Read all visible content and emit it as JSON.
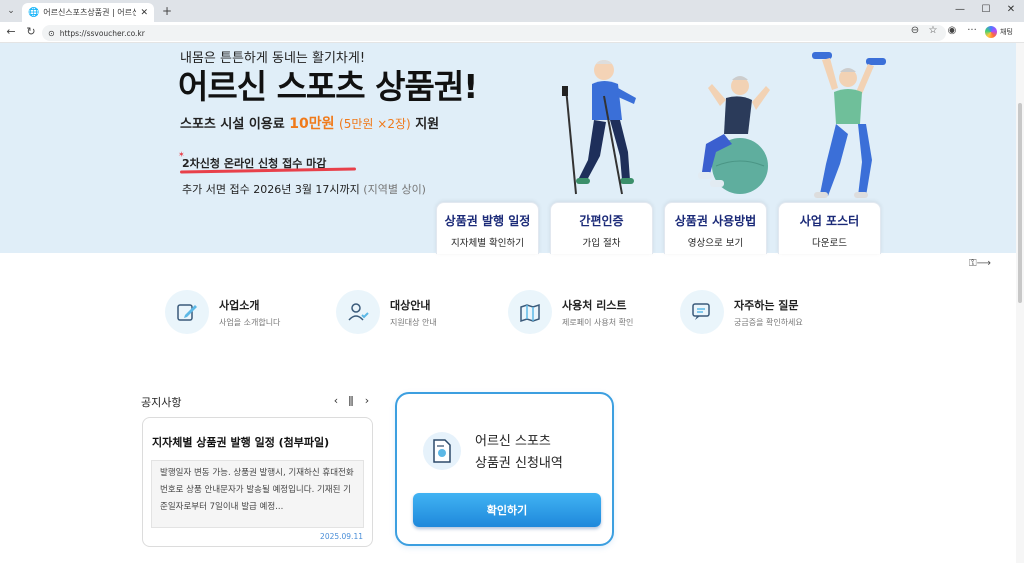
{
  "browser": {
    "tab_title": "어르신스포츠상품권 | 어르신스포",
    "url": "https://ssvoucher.co.kr",
    "copilot_label": "채팅"
  },
  "hero": {
    "subtitle": "내몸은 튼튼하게 동네는 활기차게!",
    "title": "어르신 스포츠 상품권!",
    "support_prefix": "스포츠 시설 이용료",
    "support_amount": "10만원",
    "support_detail": "(5만원 ×2장)",
    "support_suffix": "지원",
    "notice": "2차신청 온라인 신청 접수 마감",
    "extra_main": "추가 서면 접수 2026년 3월 17시까지",
    "extra_note": "(지역별 상이)"
  },
  "hero_cards": [
    {
      "title": "상품권 발행 일정",
      "sub": "지자체별 확인하기"
    },
    {
      "title": "간편인증",
      "sub": "가입 절차"
    },
    {
      "title": "상품권 사용방법",
      "sub": "영상으로 보기"
    },
    {
      "title": "사업 포스터",
      "sub": "다운로드"
    }
  ],
  "quick_links": [
    {
      "title": "사업소개",
      "sub": "사업을 소개합니다",
      "icon": "pen-note-icon"
    },
    {
      "title": "대상안내",
      "sub": "지원대상 안내",
      "icon": "user-check-icon"
    },
    {
      "title": "사용처 리스트",
      "sub": "제로페이 사용처 확인",
      "icon": "zero-map-icon"
    },
    {
      "title": "자주하는 질문",
      "sub": "궁금증을 확인하세요",
      "icon": "chat-icon"
    }
  ],
  "notice": {
    "section_title": "공지사항",
    "card_title": "지자체별 상품권 발행 일정 (첨부파일)",
    "card_body": "발행일자 변동 가능. 상품권 발행시, 기재하신 휴대전화번호로 상품 안내문자가 발송될 예정입니다. 기재된 기준일자로부터 7일이내 발급 예정...",
    "date": "2025.09.11"
  },
  "apply": {
    "line1": "어르신 스포츠",
    "line2": "상품권 신청내역",
    "button": "확인하기"
  },
  "colors": {
    "hero_bg": "#e0eef8",
    "accent_orange": "#f07a1a",
    "accent_red": "#e8404a",
    "navy": "#1b2a78",
    "button_blue": "#1f88db"
  }
}
